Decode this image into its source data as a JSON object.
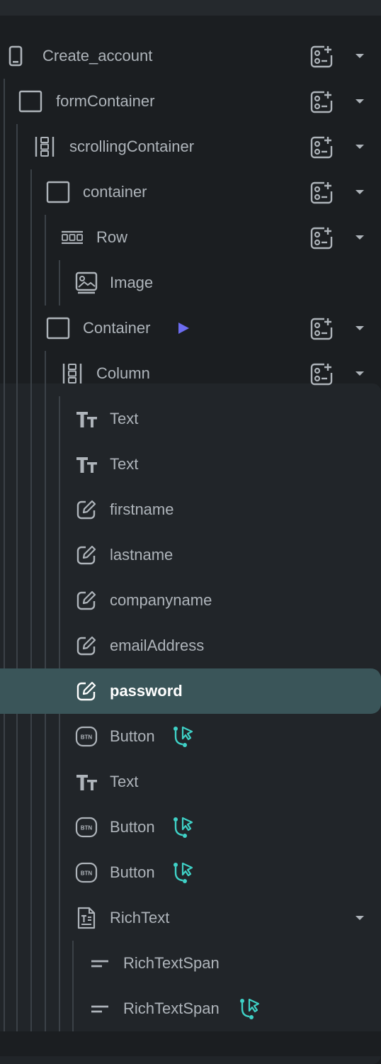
{
  "colors": {
    "background": "#1b1e21",
    "text": "#aeb4ba",
    "selected_row": "#3a5559",
    "action_accent": "#3fd2c7",
    "play_accent": "#6c6cf0"
  },
  "tree": {
    "items": [
      {
        "label": "Create_account",
        "icon": "phone-icon"
      },
      {
        "label": "formContainer",
        "icon": "container-icon"
      },
      {
        "label": "scrollingContainer",
        "icon": "column-icon"
      },
      {
        "label": "container",
        "icon": "container-icon"
      },
      {
        "label": "Row",
        "icon": "row-icon"
      },
      {
        "label": "Image",
        "icon": "image-icon"
      },
      {
        "label": "Container",
        "icon": "container-icon",
        "badge": "play-icon"
      },
      {
        "label": "Column",
        "icon": "column-icon"
      },
      {
        "label": "Text",
        "icon": "text-icon"
      },
      {
        "label": "Text",
        "icon": "text-icon"
      },
      {
        "label": "firstname",
        "icon": "textfield-icon"
      },
      {
        "label": "lastname",
        "icon": "textfield-icon"
      },
      {
        "label": "companyname",
        "icon": "textfield-icon"
      },
      {
        "label": "emailAddress",
        "icon": "textfield-icon"
      },
      {
        "label": "password",
        "icon": "textfield-icon",
        "selected": true
      },
      {
        "label": "Button",
        "icon": "button-icon",
        "badge": "action-icon"
      },
      {
        "label": "Text",
        "icon": "text-icon"
      },
      {
        "label": "Button",
        "icon": "button-icon",
        "badge": "action-icon"
      },
      {
        "label": "Button",
        "icon": "button-icon",
        "badge": "action-icon"
      },
      {
        "label": "RichText",
        "icon": "richtext-icon"
      },
      {
        "label": "RichTextSpan",
        "icon": "span-icon"
      },
      {
        "label": "RichTextSpan",
        "icon": "span-icon",
        "badge": "action-icon"
      }
    ],
    "button_icon_text": "BTN"
  }
}
